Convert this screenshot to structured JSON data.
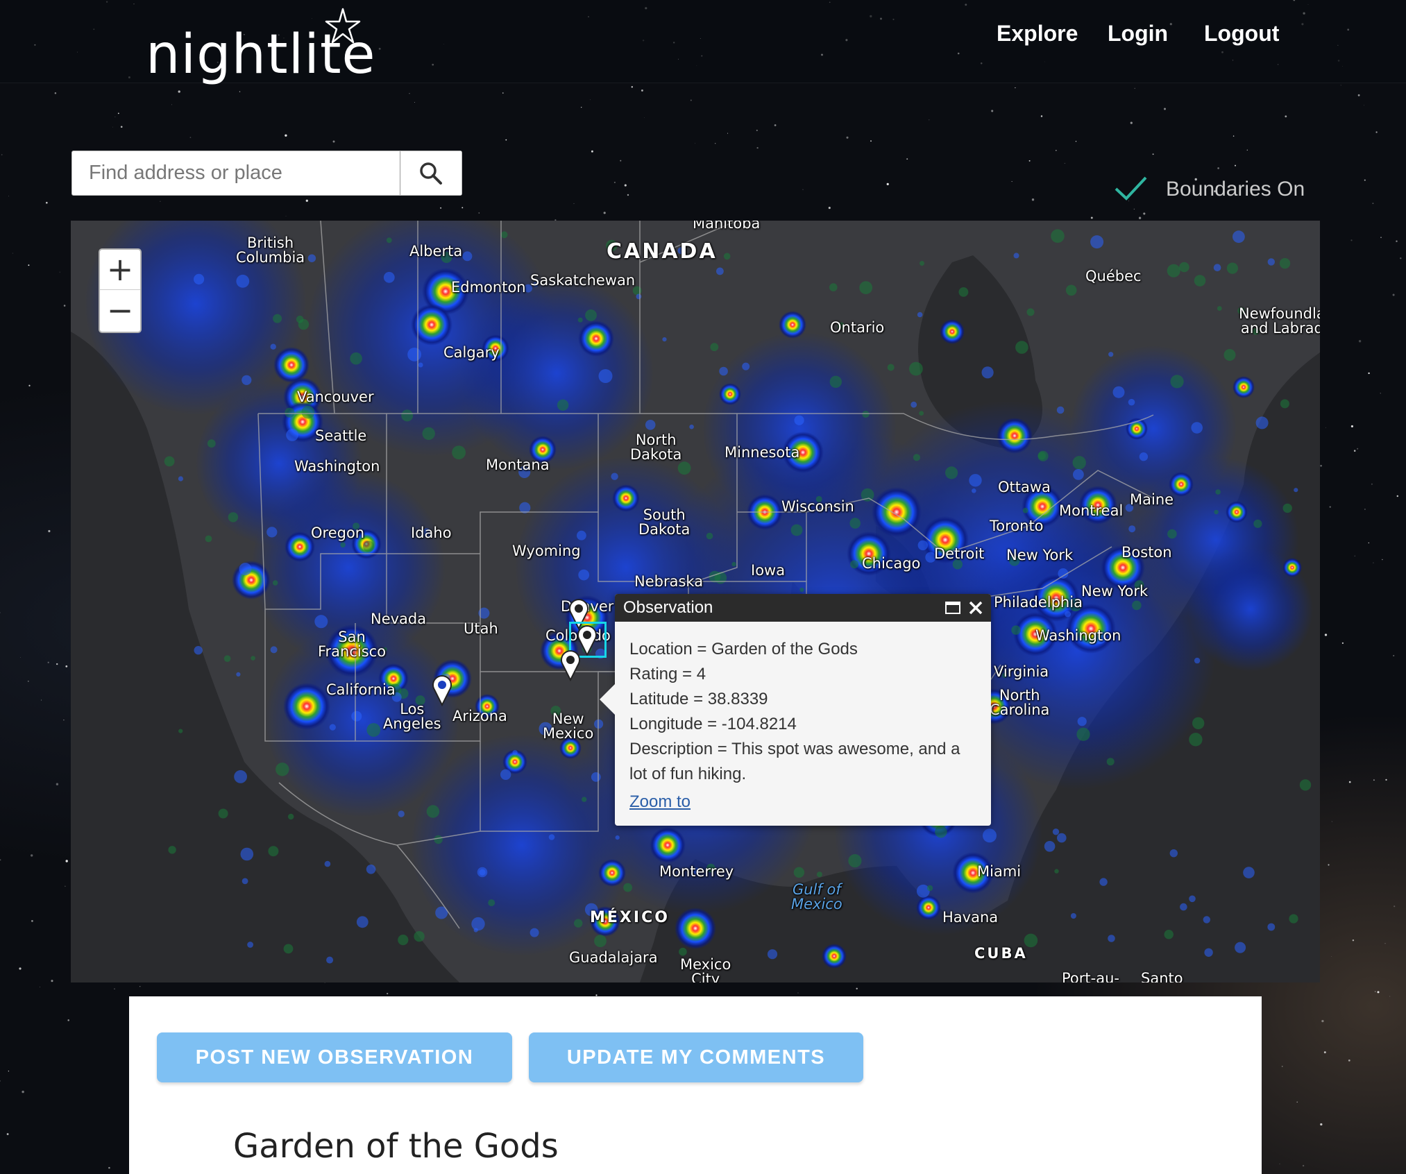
{
  "brand": {
    "name": "nightlite"
  },
  "nav": {
    "explore": "Explore",
    "login": "Login",
    "logout": "Logout"
  },
  "search": {
    "placeholder": "Find address or place",
    "value": ""
  },
  "boundaries": {
    "label": "Boundaries On",
    "checked": true
  },
  "map": {
    "zoom_in": "+",
    "zoom_out": "−",
    "labels": {
      "manitoba": "Manitoba",
      "canada": "CANADA",
      "british_columbia": "British\nColumbia",
      "alberta": "Alberta",
      "edmonton": "Edmonton",
      "saskatchewan": "Saskatchewan",
      "calgary": "Calgary",
      "quebec": "Québec",
      "newfoundland": "Newfoundla\nand Labrad",
      "ontario": "Ontario",
      "vancouver": "Vancouver",
      "seattle": "Seattle",
      "washington": "Washington",
      "montana": "Montana",
      "north_dakota": "North\nDakota",
      "minnesota": "Minnesota",
      "ottawa": "Ottawa",
      "montreal": "Montreal",
      "maine": "Maine",
      "oregon": "Oregon",
      "idaho": "Idaho",
      "south_dakota": "South\nDakota",
      "wisconsin": "Wisconsin",
      "toronto": "Toronto",
      "wyoming": "Wyoming",
      "iowa": "Iowa",
      "chicago": "Chicago",
      "detroit": "Detroit",
      "new_york_city": "New York",
      "boston": "Boston",
      "nebraska": "Nebraska",
      "new_york_state": "New York",
      "nevada": "Nevada",
      "utah": "Utah",
      "denver": "Denver",
      "colorado": "Colorado",
      "philadelphia": "Philadelphia",
      "san_francisco": "San\nFrancisco",
      "washington_dc": "Washington",
      "california": "California",
      "virginia": "Virginia",
      "north_carolina": "North\nCarolina",
      "los_angeles": "Los\nAngeles",
      "arizona": "Arizona",
      "new_mexico": "New\nMexico",
      "monterrey": "Monterrey",
      "miami": "Miami",
      "gulf_of_mexico": "Gulf of\nMexico",
      "mexico": "MÉXICO",
      "havana": "Havana",
      "guadalajara": "Guadalajara",
      "mexico_city": "Mexico\nCity",
      "cuba": "CUBA",
      "port_au_prince": "Port-au-",
      "santo": "Santo"
    }
  },
  "popup": {
    "title": "Observation",
    "location": "Location = Garden of the Gods",
    "rating": "Rating = 4",
    "latitude": "Latitude = 38.8339",
    "longitude": "Longitude = -104.8214",
    "description": "Description = This spot was awesome, and a lot of fun hiking.",
    "zoom_link": "Zoom to"
  },
  "actions": {
    "post_observation": "POST NEW OBSERVATION",
    "update_comments": "UPDATE MY COMMENTS"
  },
  "detail": {
    "title": "Garden of the Gods"
  },
  "colors": {
    "accent": "#7ec0f3",
    "check": "#2fb5a0",
    "selection": "#16d6e8"
  }
}
